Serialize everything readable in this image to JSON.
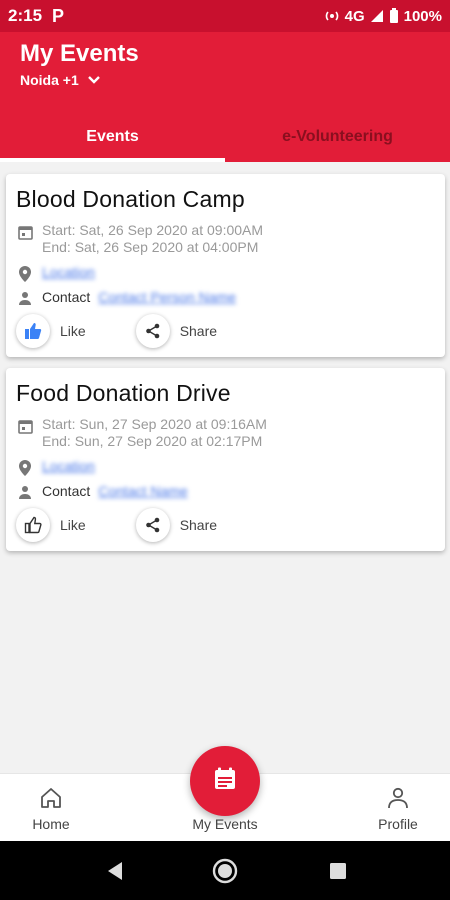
{
  "status_bar": {
    "time": "2:15",
    "app_icon": "P",
    "network": "4G",
    "battery": "100%"
  },
  "header": {
    "title": "My Events",
    "location": "Noida +1"
  },
  "tabs": [
    {
      "label": "Events",
      "active": true
    },
    {
      "label": "e-Volunteering",
      "active": false
    }
  ],
  "events": [
    {
      "title": "Blood Donation Camp",
      "start": "Start: Sat, 26 Sep 2020 at 09:00AM",
      "end": "End: Sat, 26 Sep 2020 at 04:00PM",
      "location": "Location",
      "contact_label": "Contact",
      "contact_value": "Contact Person Name",
      "like_label": "Like",
      "share_label": "Share",
      "liked": true
    },
    {
      "title": "Food Donation Drive",
      "start": "Start: Sun, 27 Sep 2020 at 09:16AM",
      "end": "End: Sun, 27 Sep 2020 at 02:17PM",
      "location": "Location",
      "contact_label": "Contact",
      "contact_value": "Contact Name",
      "like_label": "Like",
      "share_label": "Share",
      "liked": false
    }
  ],
  "bottom_nav": {
    "home": "Home",
    "my_events": "My Events",
    "profile": "Profile"
  },
  "colors": {
    "brand": "#e21d38",
    "status_bar": "#c8102e",
    "like_active": "#3b82f6"
  }
}
